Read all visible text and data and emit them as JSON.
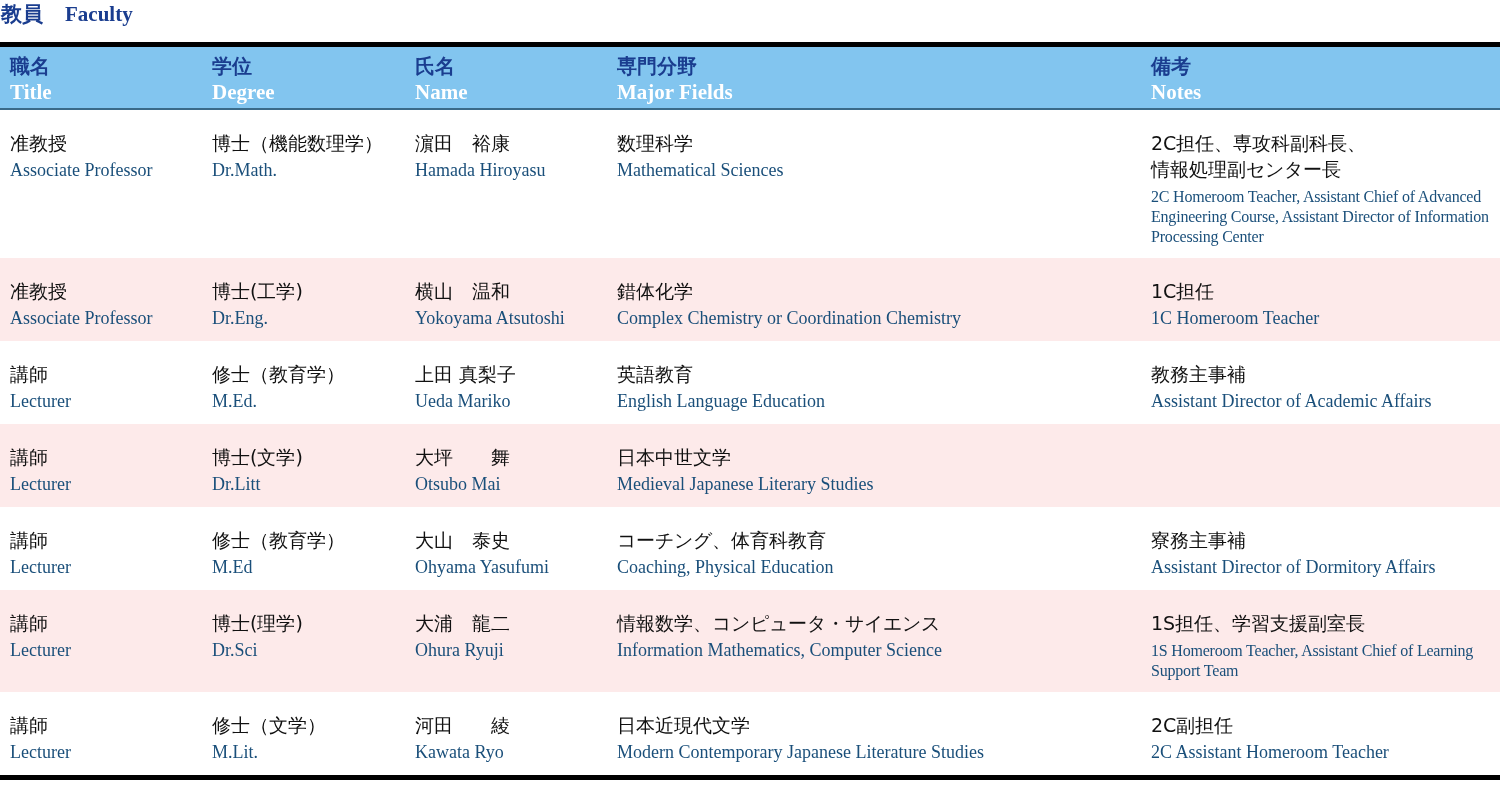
{
  "heading": {
    "ja": "教員",
    "en": "Faculty"
  },
  "columns": [
    {
      "ja": "職名",
      "en": "Title"
    },
    {
      "ja": "学位",
      "en": "Degree"
    },
    {
      "ja": "氏名",
      "en": "Name"
    },
    {
      "ja": "専門分野",
      "en": "Major Fields"
    },
    {
      "ja": "備考",
      "en": "Notes"
    }
  ],
  "rows": [
    {
      "title": {
        "ja": "准教授",
        "en": "Associate Professor"
      },
      "degree": {
        "ja": "博士（機能数理学）",
        "en": "Dr.Math."
      },
      "name": {
        "ja": "濵田　裕康",
        "en": "Hamada Hiroyasu"
      },
      "field": {
        "ja": "数理科学",
        "en": "Mathematical Sciences"
      },
      "notes": {
        "ja": "2C担任、専攻科副科長、",
        "ja2": "情報処理副センター長",
        "en": "2C Homeroom Teacher, Assistant Chief of Advanced Engineering Course, Assistant Director of Information Processing Center"
      }
    },
    {
      "title": {
        "ja": "准教授",
        "en": "Associate Professor"
      },
      "degree": {
        "ja": "博士(工学)",
        "en": "Dr.Eng."
      },
      "name": {
        "ja": "横山　温和",
        "en": "Yokoyama Atsutoshi"
      },
      "field": {
        "ja": "錯体化学",
        "en": "Complex Chemistry or Coordination Chemistry"
      },
      "notes": {
        "ja": "1C担任",
        "en": "1C Homeroom Teacher"
      }
    },
    {
      "title": {
        "ja": "講師",
        "en": "Lecturer"
      },
      "degree": {
        "ja": "修士（教育学）",
        "en": "M.Ed."
      },
      "name": {
        "ja": "上田 真梨子",
        "en": "Ueda Mariko"
      },
      "field": {
        "ja": "英語教育",
        "en": "English Language Education"
      },
      "notes": {
        "ja": "教務主事補",
        "en": "Assistant Director of Academic Affairs"
      }
    },
    {
      "title": {
        "ja": "講師",
        "en": "Lecturer"
      },
      "degree": {
        "ja": "博士(文学)",
        "en": "Dr.Litt"
      },
      "name": {
        "ja": "大坪　　舞",
        "en": "Otsubo Mai"
      },
      "field": {
        "ja": "日本中世文学",
        "en": "Medieval Japanese Literary Studies"
      }
    },
    {
      "title": {
        "ja": "講師",
        "en": "Lecturer"
      },
      "degree": {
        "ja": "修士（教育学）",
        "en": "M.Ed"
      },
      "name": {
        "ja": "大山　泰史",
        "en": "Ohyama Yasufumi"
      },
      "field": {
        "ja": "コーチング、体育科教育",
        "en": "Coaching,  Physical Education"
      },
      "notes": {
        "ja": "寮務主事補",
        "en": "Assistant Director of Dormitory Affairs"
      }
    },
    {
      "title": {
        "ja": "講師",
        "en": "Lecturer"
      },
      "degree": {
        "ja": "博士(理学)",
        "en": "Dr.Sci"
      },
      "name": {
        "ja": "大浦　龍二",
        "en": "Ohura Ryuji"
      },
      "field": {
        "ja": "情報数学、コンピュータ・サイエンス",
        "en": "Information Mathematics, Computer Science"
      },
      "notes": {
        "ja": "1S担任、学習支援副室長",
        "en": "1S Homeroom Teacher, Assistant Chief of Learning Support Team"
      }
    },
    {
      "title": {
        "ja": "講師",
        "en": "Lecturer"
      },
      "degree": {
        "ja": "修士（文学）",
        "en": "M.Lit."
      },
      "name": {
        "ja": "河田　　綾",
        "en": "Kawata Ryo"
      },
      "field": {
        "ja": "日本近現代文学",
        "en": "Modern Contemporary Japanese Literature Studies"
      },
      "notes": {
        "ja": "2C副担任",
        "en": "2C Assistant Homeroom Teacher"
      }
    }
  ]
}
